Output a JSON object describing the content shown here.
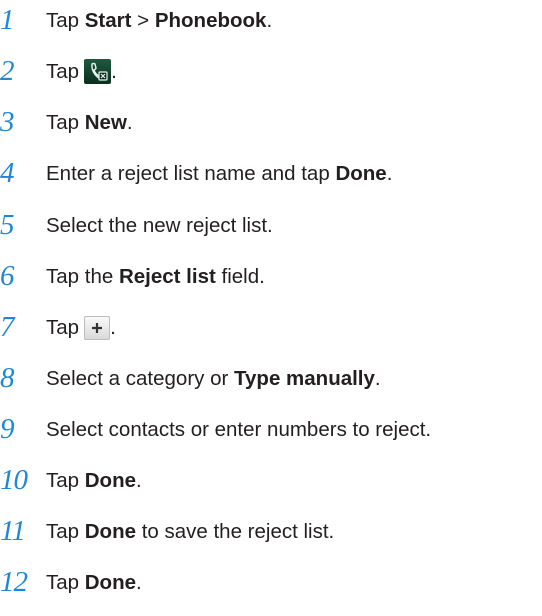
{
  "steps": [
    {
      "number": "1",
      "parts": [
        {
          "t": "Tap ",
          "b": false
        },
        {
          "t": "Start",
          "b": true
        },
        {
          "t": " > ",
          "b": false
        },
        {
          "t": "Phonebook",
          "b": true
        },
        {
          "t": ".",
          "b": false
        }
      ]
    },
    {
      "number": "2",
      "parts": [
        {
          "t": "Tap",
          "b": false
        },
        {
          "icon": "reject-list-icon"
        },
        {
          "t": ".",
          "b": false
        }
      ]
    },
    {
      "number": "3",
      "parts": [
        {
          "t": "Tap ",
          "b": false
        },
        {
          "t": "New",
          "b": true
        },
        {
          "t": ".",
          "b": false
        }
      ]
    },
    {
      "number": "4",
      "parts": [
        {
          "t": "Enter a reject list name and tap ",
          "b": false
        },
        {
          "t": "Done",
          "b": true
        },
        {
          "t": ".",
          "b": false
        }
      ]
    },
    {
      "number": "5",
      "parts": [
        {
          "t": "Select the new reject list.",
          "b": false
        }
      ]
    },
    {
      "number": "6",
      "parts": [
        {
          "t": "Tap the ",
          "b": false
        },
        {
          "t": "Reject list",
          "b": true
        },
        {
          "t": " field.",
          "b": false
        }
      ]
    },
    {
      "number": "7",
      "parts": [
        {
          "t": "Tap",
          "b": false
        },
        {
          "icon": "plus-icon"
        },
        {
          "t": ".",
          "b": false
        }
      ]
    },
    {
      "number": "8",
      "parts": [
        {
          "t": "Select a category or ",
          "b": false
        },
        {
          "t": "Type manually",
          "b": true
        },
        {
          "t": ".",
          "b": false
        }
      ]
    },
    {
      "number": "9",
      "parts": [
        {
          "t": "Select contacts or enter numbers to reject.",
          "b": false
        }
      ]
    },
    {
      "number": "10",
      "parts": [
        {
          "t": "Tap ",
          "b": false
        },
        {
          "t": "Done",
          "b": true
        },
        {
          "t": ".",
          "b": false
        }
      ]
    },
    {
      "number": "11",
      "parts": [
        {
          "t": "Tap ",
          "b": false
        },
        {
          "t": "Done",
          "b": true
        },
        {
          "t": " to save the reject list.",
          "b": false
        }
      ]
    },
    {
      "number": "12",
      "parts": [
        {
          "t": "Tap ",
          "b": false
        },
        {
          "t": "Done",
          "b": true
        },
        {
          "t": ".",
          "b": false
        }
      ]
    }
  ],
  "colors": {
    "step_number": "#1e88d6",
    "text": "#231f20"
  }
}
